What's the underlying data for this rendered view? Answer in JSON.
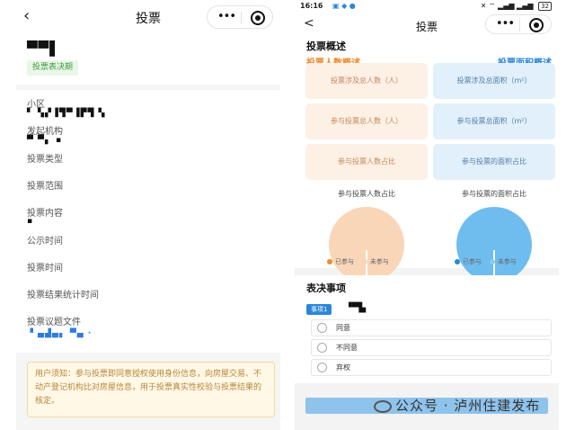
{
  "left": {
    "nav": {
      "back": "‹",
      "title": "投票",
      "menu_dots": "•••"
    },
    "header": {
      "vote_title": "▀▀▌",
      "status_tag": "投票表决期"
    },
    "fields": [
      {
        "label": "小区",
        "value": "▘ ▚▞▐▜▀▐▛▜ ▚"
      },
      {
        "label": "发起机构",
        "value": "▀ ▀▖ ▪"
      },
      {
        "label": "投票类型",
        "value": ""
      },
      {
        "label": "投票范围",
        "value": ""
      },
      {
        "label": "投票内容",
        "value": "▪"
      },
      {
        "label": "公示时间",
        "value": ""
      },
      {
        "label": "投票时间",
        "value": ""
      },
      {
        "label": "投票结果统计时间",
        "value": ""
      },
      {
        "label": "投票议题文件",
        "value": "▝ ▄▟▄▖ ▀▄  ·"
      }
    ],
    "notice": "用户须知：参与投票即同意授权使用身份信息，向房屋交易、不动产登记机构比对房屋信息，用于投票真实性校验与投票结果的核定。"
  },
  "right": {
    "status": {
      "time": "16:16",
      "icons": "▣ ◆ ●",
      "right": "✕ ⌔ ▂▄▆ ▂▄▆",
      "battery": "32"
    },
    "nav": {
      "back": "<",
      "title": "投票",
      "menu_dots": "•••"
    },
    "overview": {
      "title": "投票概述",
      "people_title": "投票人数概述",
      "area_title": "投票面积概述",
      "people_boxes": [
        "投票涉及总人数（人）",
        "参与投票总人数（人）",
        "参与投票人数占比"
      ],
      "area_boxes": [
        "投票涉及总面积（m²）",
        "参与投票总面积（m²）",
        "参与投票的面积占比"
      ],
      "people_pie_caption": "参与投票人数占比",
      "area_pie_caption": "参与投票的面积占比",
      "legend_people": [
        "已参与",
        "未参与"
      ],
      "legend_area": [
        "已参与",
        "未参与"
      ]
    },
    "matters": {
      "title": "表决事项",
      "item_tag": "事项1",
      "item_name": "▝▀▙",
      "options": [
        "同意",
        "不同意",
        "弃权"
      ]
    }
  },
  "watermark": "公众号 · 泸州住建发布",
  "colors": {
    "orange": "#f08a2b",
    "blue": "#2b86d8",
    "notice_bg": "#fff8e6",
    "tag_green": "#3a9a3a"
  }
}
